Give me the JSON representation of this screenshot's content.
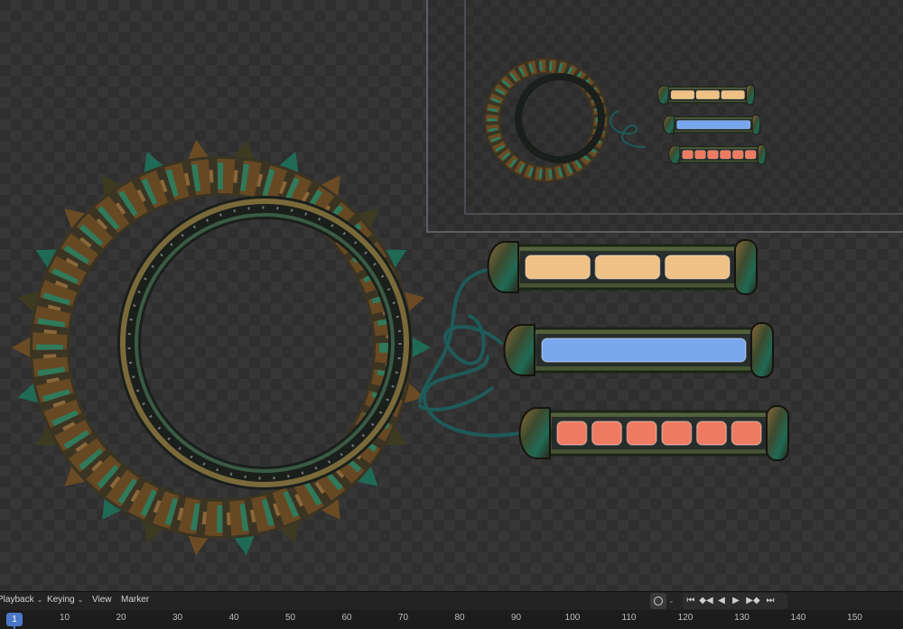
{
  "timeline": {
    "menus": [
      {
        "label": "Playback",
        "has_caret": true
      },
      {
        "label": "Keying",
        "has_caret": true
      },
      {
        "label": "View",
        "has_caret": false
      },
      {
        "label": "Marker",
        "has_caret": false
      }
    ],
    "current_frame": "1",
    "ruler_ticks": [
      "10",
      "20",
      "30",
      "40",
      "50",
      "60",
      "70",
      "80",
      "90",
      "100",
      "110",
      "120",
      "130",
      "140",
      "150"
    ],
    "controls": {
      "record": "record-icon",
      "jump_start": "jump-to-start-icon",
      "prev_keyframe": "previous-keyframe-icon",
      "play_reverse": "play-reverse-icon",
      "play": "play-icon",
      "next_keyframe": "next-keyframe-icon",
      "jump_end": "jump-to-end-icon"
    }
  },
  "artwork": {
    "gauges": [
      {
        "name": "top-gauge",
        "color": "#f0c184",
        "segments": 3,
        "fill": 1.0
      },
      {
        "name": "middle-gauge",
        "color": "#79a7ee",
        "segments": 1,
        "fill": 1.0
      },
      {
        "name": "bottom-gauge",
        "color": "#ee7a62",
        "segments": 6,
        "fill": 1.0
      }
    ],
    "ring_colors": {
      "bronze": "#6b4b24",
      "teal": "#1f8a6e",
      "dark": "#1a1f1c"
    },
    "accent": "#4b78c8"
  }
}
